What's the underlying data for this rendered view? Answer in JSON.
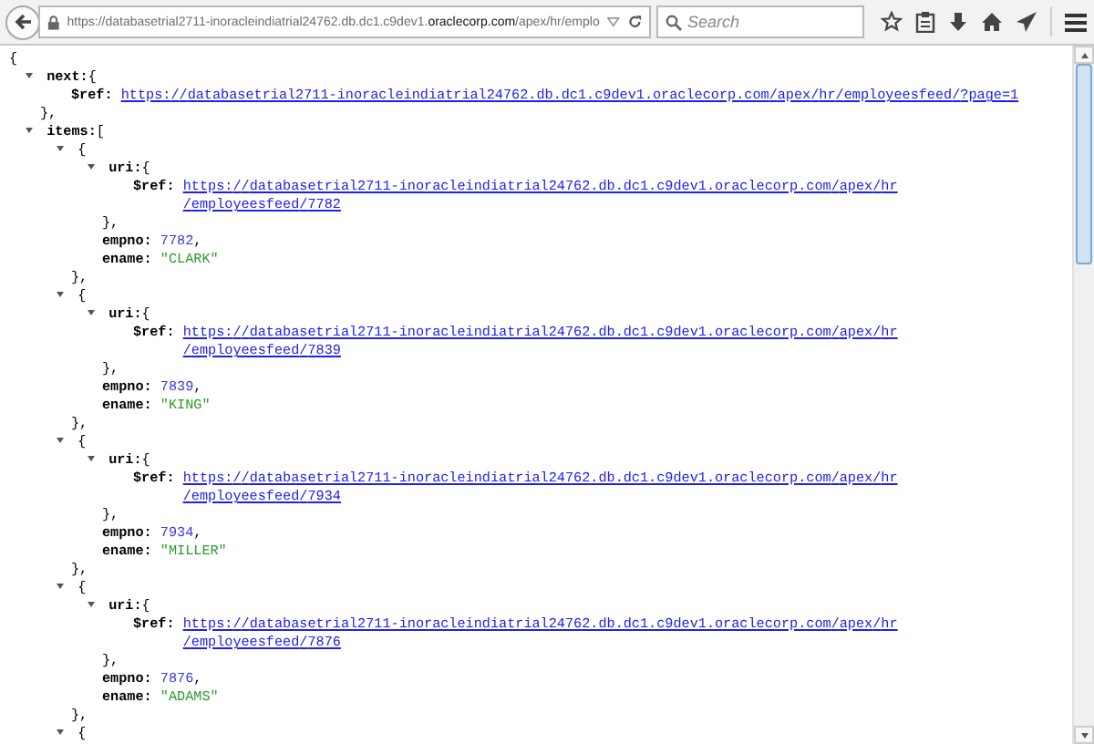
{
  "browser": {
    "url_prefix": "https://databasetrial2711-inoracleindiatrial24762.db.dc1.c9dev1.",
    "url_domain": "oraclecorp.com",
    "url_suffix": "/apex/hr/emplo",
    "search_placeholder": "Search"
  },
  "json_view": {
    "open": "{",
    "children": [
      {
        "key": "next:",
        "open": "{",
        "expanded": true,
        "close": "},",
        "children": [
          {
            "kind": "link",
            "key": "$ref:",
            "value": "https://databasetrial2711-inoracleindiatrial24762.db.dc1.c9dev1.oraclecorp.com/apex/hr/employeesfeed/?page=1"
          }
        ]
      },
      {
        "key": "items:",
        "open": "[",
        "expanded": true,
        "children": [
          {
            "open": "{",
            "expanded": true,
            "close": "},",
            "children": [
              {
                "key": "uri:",
                "open": "{",
                "expanded": true,
                "close": "},",
                "children": [
                  {
                    "kind": "link",
                    "key": "$ref:",
                    "value": "https://databasetrial2711-inoracleindiatrial24762.db.dc1.c9dev1.oraclecorp.com/apex/hr/employeesfeed/7782"
                  }
                ]
              },
              {
                "kind": "number",
                "key": "empno:",
                "value": "7782",
                "separator": ","
              },
              {
                "kind": "string",
                "key": "ename:",
                "value": "\"CLARK\""
              }
            ]
          },
          {
            "open": "{",
            "expanded": true,
            "close": "},",
            "children": [
              {
                "key": "uri:",
                "open": "{",
                "expanded": true,
                "close": "},",
                "children": [
                  {
                    "kind": "link",
                    "key": "$ref:",
                    "value": "https://databasetrial2711-inoracleindiatrial24762.db.dc1.c9dev1.oraclecorp.com/apex/hr/employeesfeed/7839"
                  }
                ]
              },
              {
                "kind": "number",
                "key": "empno:",
                "value": "7839",
                "separator": ","
              },
              {
                "kind": "string",
                "key": "ename:",
                "value": "\"KING\""
              }
            ]
          },
          {
            "open": "{",
            "expanded": true,
            "close": "},",
            "children": [
              {
                "key": "uri:",
                "open": "{",
                "expanded": true,
                "close": "},",
                "children": [
                  {
                    "kind": "link",
                    "key": "$ref:",
                    "value": "https://databasetrial2711-inoracleindiatrial24762.db.dc1.c9dev1.oraclecorp.com/apex/hr/employeesfeed/7934"
                  }
                ]
              },
              {
                "kind": "number",
                "key": "empno:",
                "value": "7934",
                "separator": ","
              },
              {
                "kind": "string",
                "key": "ename:",
                "value": "\"MILLER\""
              }
            ]
          },
          {
            "open": "{",
            "expanded": true,
            "close": "},",
            "children": [
              {
                "key": "uri:",
                "open": "{",
                "expanded": true,
                "close": "},",
                "children": [
                  {
                    "kind": "link",
                    "key": "$ref:",
                    "value": "https://databasetrial2711-inoracleindiatrial24762.db.dc1.c9dev1.oraclecorp.com/apex/hr/employeesfeed/7876"
                  }
                ]
              },
              {
                "kind": "number",
                "key": "empno:",
                "value": "7876",
                "separator": ","
              },
              {
                "kind": "string",
                "key": "ename:",
                "value": "\"ADAMS\""
              }
            ]
          },
          {
            "open": "{",
            "expanded": true
          }
        ]
      }
    ]
  }
}
